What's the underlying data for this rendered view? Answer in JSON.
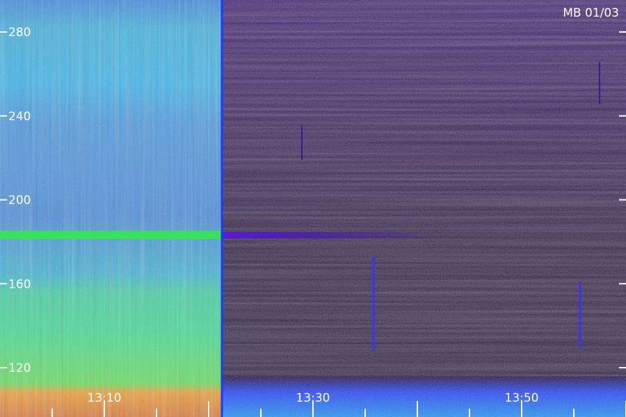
{
  "chart_data": {
    "type": "heatmap",
    "title": "MB 01/03",
    "xlabel": "",
    "ylabel": "",
    "x_ticks": [
      "13:10",
      "13:30",
      "13:50"
    ],
    "y_ticks": [
      280,
      240,
      200,
      160,
      120
    ],
    "ylim": [
      110,
      295
    ],
    "colormap": [
      "#2a0070",
      "#1a3cff",
      "#19b6ff",
      "#20e88a",
      "#8cf020",
      "#ff9a10",
      "#e81a10"
    ],
    "features": {
      "strong_emission_until": "13:20",
      "narrow_band_frequency": 183,
      "low_frequency_band_top": 116
    }
  }
}
